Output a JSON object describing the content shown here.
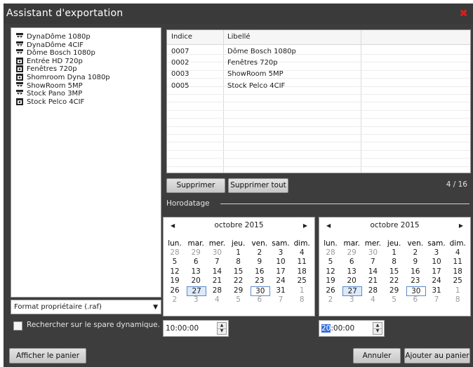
{
  "window": {
    "title": "Assistant d'exportation",
    "close_glyph": "✖"
  },
  "cameras": [
    {
      "label": "DynaDôme 1080p",
      "icon": "dome-camera-icon"
    },
    {
      "label": "DynaDôme 4CIF",
      "icon": "dome-camera-icon"
    },
    {
      "label": "Dôme Bosch 1080p",
      "icon": "dome-camera-icon"
    },
    {
      "label": "Entrée HD 720p",
      "icon": "box-camera-icon"
    },
    {
      "label": "Fenêtres 720p",
      "icon": "box-camera-icon"
    },
    {
      "label": "Shomroom Dyna 1080p",
      "icon": "box-camera-icon"
    },
    {
      "label": "ShowRoom 5MP",
      "icon": "dome-camera-icon"
    },
    {
      "label": "Stock Pano 3MP",
      "icon": "dome-camera-icon"
    },
    {
      "label": "Stock Pelco 4CIF",
      "icon": "box-camera-icon"
    }
  ],
  "table": {
    "headers": [
      "Indice",
      "Libellé"
    ],
    "rows": [
      [
        "0007",
        "Dôme Bosch 1080p"
      ],
      [
        "0002",
        "Fenêtres 720p"
      ],
      [
        "0003",
        "ShowRoom 5MP"
      ],
      [
        "0005",
        "Stock Pelco 4CIF"
      ]
    ]
  },
  "buttons": {
    "delete": "Supprimer",
    "delete_all": "Supprimer tout",
    "show_cart": "Afficher le panier",
    "cancel": "Annuler",
    "add_to_cart": "Ajouter au panier"
  },
  "counter": "4 / 16",
  "timestamp_label": "Horodatage",
  "calendars": [
    {
      "title": "octobre 2015",
      "weekdays": [
        "lun.",
        "mar.",
        "mer.",
        "jeu.",
        "ven.",
        "sam.",
        "dim."
      ],
      "weeks": [
        [
          "28",
          "29",
          "30",
          "1",
          "2",
          "3",
          "4"
        ],
        [
          "5",
          "6",
          "7",
          "8",
          "9",
          "10",
          "11"
        ],
        [
          "12",
          "13",
          "14",
          "15",
          "16",
          "17",
          "18"
        ],
        [
          "19",
          "20",
          "21",
          "22",
          "23",
          "24",
          "25"
        ],
        [
          "26",
          "27",
          "28",
          "29",
          "30",
          "31",
          "1"
        ],
        [
          "2",
          "3",
          "4",
          "5",
          "6",
          "7",
          "8"
        ]
      ],
      "selected": "27",
      "today": "30"
    },
    {
      "title": "octobre 2015",
      "weekdays": [
        "lun.",
        "mar.",
        "mer.",
        "jeu.",
        "ven.",
        "sam.",
        "dim."
      ],
      "weeks": [
        [
          "28",
          "29",
          "30",
          "1",
          "2",
          "3",
          "4"
        ],
        [
          "5",
          "6",
          "7",
          "8",
          "9",
          "10",
          "11"
        ],
        [
          "12",
          "13",
          "14",
          "15",
          "16",
          "17",
          "18"
        ],
        [
          "19",
          "20",
          "21",
          "22",
          "23",
          "24",
          "25"
        ],
        [
          "26",
          "27",
          "28",
          "29",
          "30",
          "31",
          "1"
        ],
        [
          "2",
          "3",
          "4",
          "5",
          "6",
          "7",
          "8"
        ]
      ],
      "selected": "27",
      "today": "30"
    }
  ],
  "format_select": {
    "value": "Format propriétaire (.raf)"
  },
  "checkbox_label": "Rechercher sur le spare dynamique.",
  "time_start": "10:00:00",
  "time_end": {
    "hour": "20",
    "rest": ":00:00"
  },
  "colors": {
    "window_bg": "#3d3d3d",
    "close": "#d42020",
    "selection": "#3a6fd8"
  }
}
